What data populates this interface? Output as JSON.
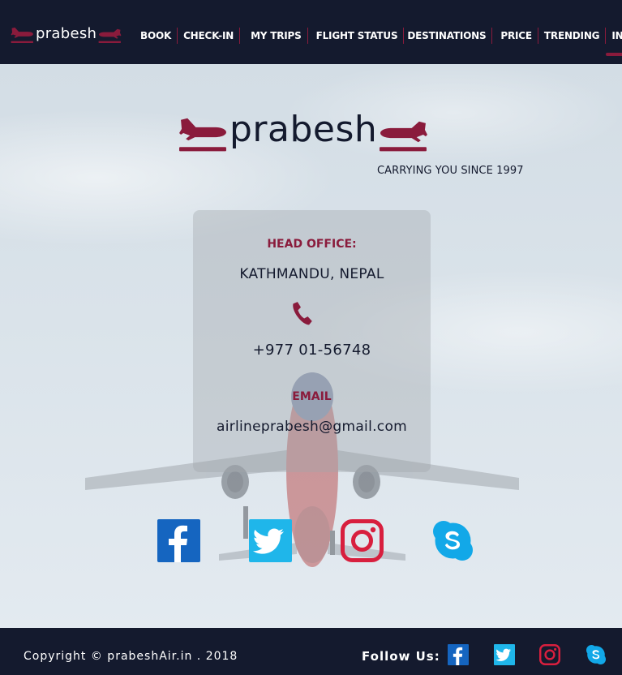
{
  "nav": {
    "logo_text": "prabesh",
    "items": [
      {
        "label": "BOOK"
      },
      {
        "label": "CHECK-IN"
      },
      {
        "label": "MY TRIPS"
      },
      {
        "label": "FLIGHT STATUS"
      },
      {
        "label": "DESTINATIONS"
      },
      {
        "label": "PRICE"
      },
      {
        "label": "TRENDING"
      },
      {
        "label": "INFO",
        "active": true
      }
    ]
  },
  "brand": {
    "name": "prabesh",
    "tagline": "CARRYING YOU SINCE 1997"
  },
  "contact": {
    "head_office_label": "HEAD OFFICE:",
    "head_office_value": "KATHMANDU, NEPAL",
    "phone_icon": "phone-icon",
    "phone": "+977 01-56748",
    "email_label": "EMAIL",
    "email": "airlineprabesh@gmail.com"
  },
  "social": [
    {
      "name": "facebook-icon",
      "color": "#1877f2"
    },
    {
      "name": "twitter-icon",
      "color": "#1da1f2"
    },
    {
      "name": "instagram-icon",
      "color": "#e1306c"
    },
    {
      "name": "skype-icon",
      "color": "#00aff0"
    }
  ],
  "footer": {
    "copyright": "Copyright © prabeshAir.in . 2018",
    "follow_label": "Follow Us:"
  },
  "colors": {
    "navy": "#141a2e",
    "maroon": "#8a1b3c"
  }
}
